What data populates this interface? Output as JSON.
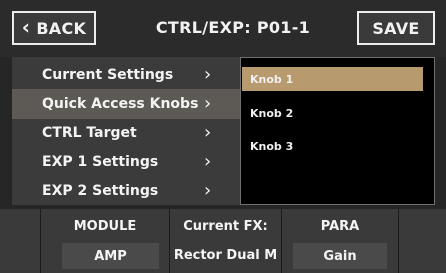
{
  "header": {
    "back_label": "BACK",
    "title": "CTRL/EXP: P01-1",
    "save_label": "SAVE"
  },
  "menu": {
    "items": [
      {
        "label": "Current Settings",
        "selected": false
      },
      {
        "label": "Quick Access Knobs",
        "selected": true
      },
      {
        "label": "CTRL Target",
        "selected": false
      },
      {
        "label": "EXP 1 Settings",
        "selected": false
      },
      {
        "label": "EXP 2 Settings",
        "selected": false
      }
    ],
    "chevron_icon": "chevron-right-icon"
  },
  "knobs": {
    "items": [
      {
        "label": "Knob 1",
        "selected": true
      },
      {
        "label": "Knob 2",
        "selected": false
      },
      {
        "label": "Knob 3",
        "selected": false
      }
    ]
  },
  "bottom": {
    "module_label": "MODULE",
    "module_value": "AMP",
    "current_fx_label": "Current FX:",
    "current_fx_value": "Rector Dual M",
    "para_label": "PARA",
    "para_value": "Gain"
  },
  "colors": {
    "accent": "#b89a6f",
    "menu_selected": "#5d5a55",
    "panel_bg": "#3b3b3b"
  }
}
